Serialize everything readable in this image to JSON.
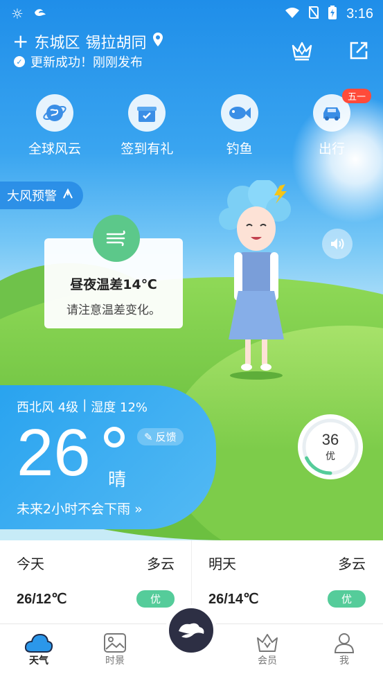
{
  "status_bar": {
    "time": "3:16"
  },
  "location": {
    "district": "东城区",
    "street": "锡拉胡同",
    "update_text": "更新成功！刚刚发布"
  },
  "shortcuts": [
    {
      "label": "全球风云",
      "icon": "globe-icon"
    },
    {
      "label": "签到有礼",
      "icon": "gift-icon"
    },
    {
      "label": "钓鱼",
      "icon": "fish-icon"
    },
    {
      "label": "出行",
      "icon": "car-icon",
      "badge": "五一"
    }
  ],
  "warning": {
    "label": "大风预警"
  },
  "tip": {
    "title": "昼夜温差14℃",
    "subtitle": "请注意温差变化。"
  },
  "current": {
    "wind": "西北风 4级",
    "separator": "|",
    "humidity": "湿度 12%",
    "temperature": "26",
    "condition": "晴",
    "feedback": "反馈",
    "rain": "未来2小时不会下雨",
    "rain_chevron": "»"
  },
  "aqi": {
    "value": "36",
    "label": "优",
    "fraction": 0.36
  },
  "forecast": [
    {
      "day": "今天",
      "condition": "多云",
      "temps": "26/12℃",
      "aqi": "优"
    },
    {
      "day": "明天",
      "condition": "多云",
      "temps": "26/14℃",
      "aqi": "优"
    }
  ],
  "nav": [
    {
      "label": "天气",
      "icon": "cloud-icon"
    },
    {
      "label": "时景",
      "icon": "picture-icon"
    },
    {
      "label": "会员",
      "icon": "vip-icon"
    },
    {
      "label": "我",
      "icon": "user-icon"
    }
  ],
  "colors": {
    "accent": "#2b97ea",
    "good_aqi": "#55cc9a",
    "badge": "#ff4b3a",
    "nav_center": "#2d2f44"
  }
}
